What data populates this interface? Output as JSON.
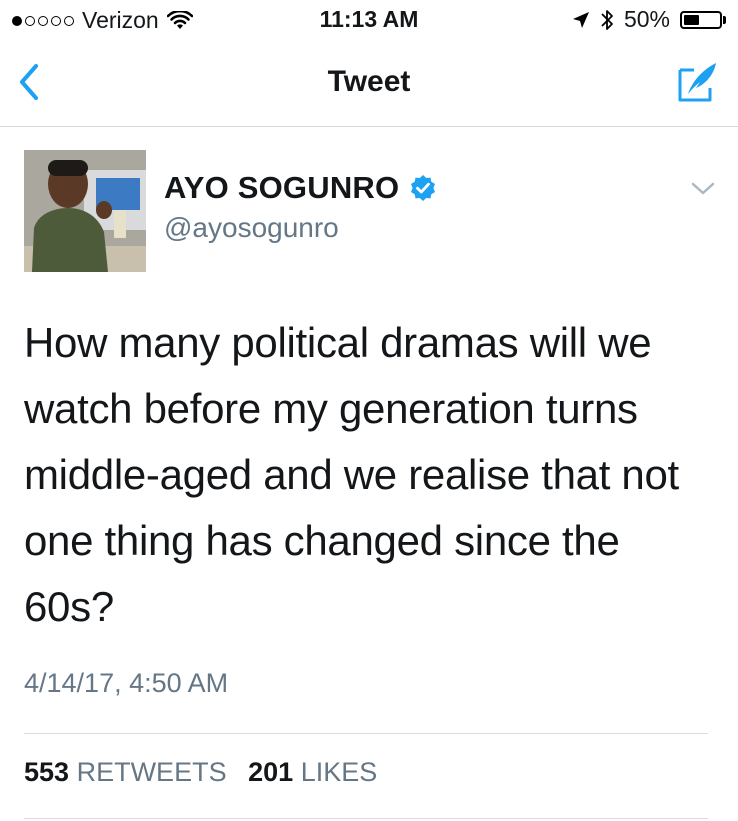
{
  "status_bar": {
    "carrier": "Verizon",
    "signal_bars_filled": 1,
    "signal_bars_total": 5,
    "time": "11:13 AM",
    "battery_percent_label": "50%",
    "battery_level": 0.5
  },
  "nav": {
    "title": "Tweet",
    "back_icon": "chevron-left-icon",
    "compose_icon": "compose-tweet-icon",
    "accent_color": "#1da1f2"
  },
  "tweet": {
    "author_name": "AYO SOGUNRO",
    "verified": true,
    "handle": "@ayosogunro",
    "text": "How many political dramas will we watch before my generation turns middle-aged and we realise that not one thing has changed since the 60s?",
    "timestamp": "4/14/17, 4:50 AM",
    "retweets_count": "553",
    "retweets_label": "RETWEETS",
    "likes_count": "201",
    "likes_label": "LIKES"
  }
}
